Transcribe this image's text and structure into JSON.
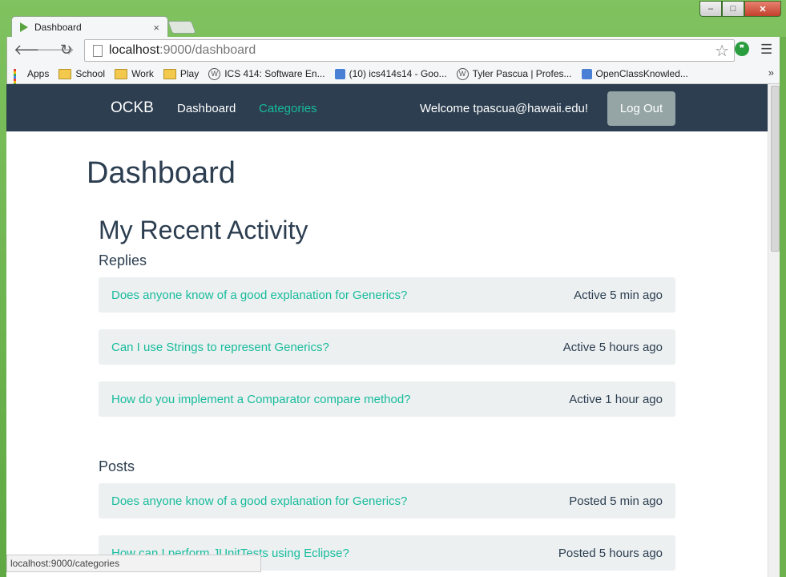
{
  "browser": {
    "tab_title": "Dashboard",
    "tab_close": "×",
    "url_host": "localhost",
    "url_rest": ":9000/dashboard",
    "bookmarks": [
      {
        "label": "Apps",
        "icon": "apps-grid-icon"
      },
      {
        "label": "School",
        "icon": "folder-icon"
      },
      {
        "label": "Work",
        "icon": "folder-icon"
      },
      {
        "label": "Play",
        "icon": "folder-icon"
      },
      {
        "label": "ICS 414: Software En...",
        "icon": "wordpress-icon"
      },
      {
        "label": "(10) ics414s14 - Goo...",
        "icon": "classroom-icon"
      },
      {
        "label": "Tyler Pascua | Profes...",
        "icon": "wordpress-icon"
      },
      {
        "label": "OpenClassKnowled...",
        "icon": "classroom-icon"
      }
    ],
    "status_text": "localhost:9000/categories"
  },
  "nav": {
    "brand": "OCKB",
    "links": [
      "Dashboard",
      "Categories"
    ],
    "welcome": "Welcome tpascua@hawaii.edu!",
    "logout": "Log Out"
  },
  "page": {
    "title": "Dashboard",
    "section": "My Recent Activity",
    "replies_heading": "Replies",
    "replies": [
      {
        "question": "Does anyone know of a good explanation for Generics?",
        "meta": "Active 5 min ago"
      },
      {
        "question": "Can I use Strings to represent Generics?",
        "meta": "Active 5 hours ago"
      },
      {
        "question": "How do you implement a Comparator compare method?",
        "meta": "Active 1 hour ago"
      }
    ],
    "posts_heading": "Posts",
    "posts": [
      {
        "question": "Does anyone know of a good explanation for Generics?",
        "meta": "Posted 5 min ago"
      },
      {
        "question": "How can I perform JUnitTests using Eclipse?",
        "meta": "Posted 5 hours ago"
      }
    ]
  },
  "colors": {
    "navbar": "#2c3e50",
    "accent": "#18bc9c",
    "row_bg": "#ecf0f1",
    "button": "#95a5a6"
  }
}
